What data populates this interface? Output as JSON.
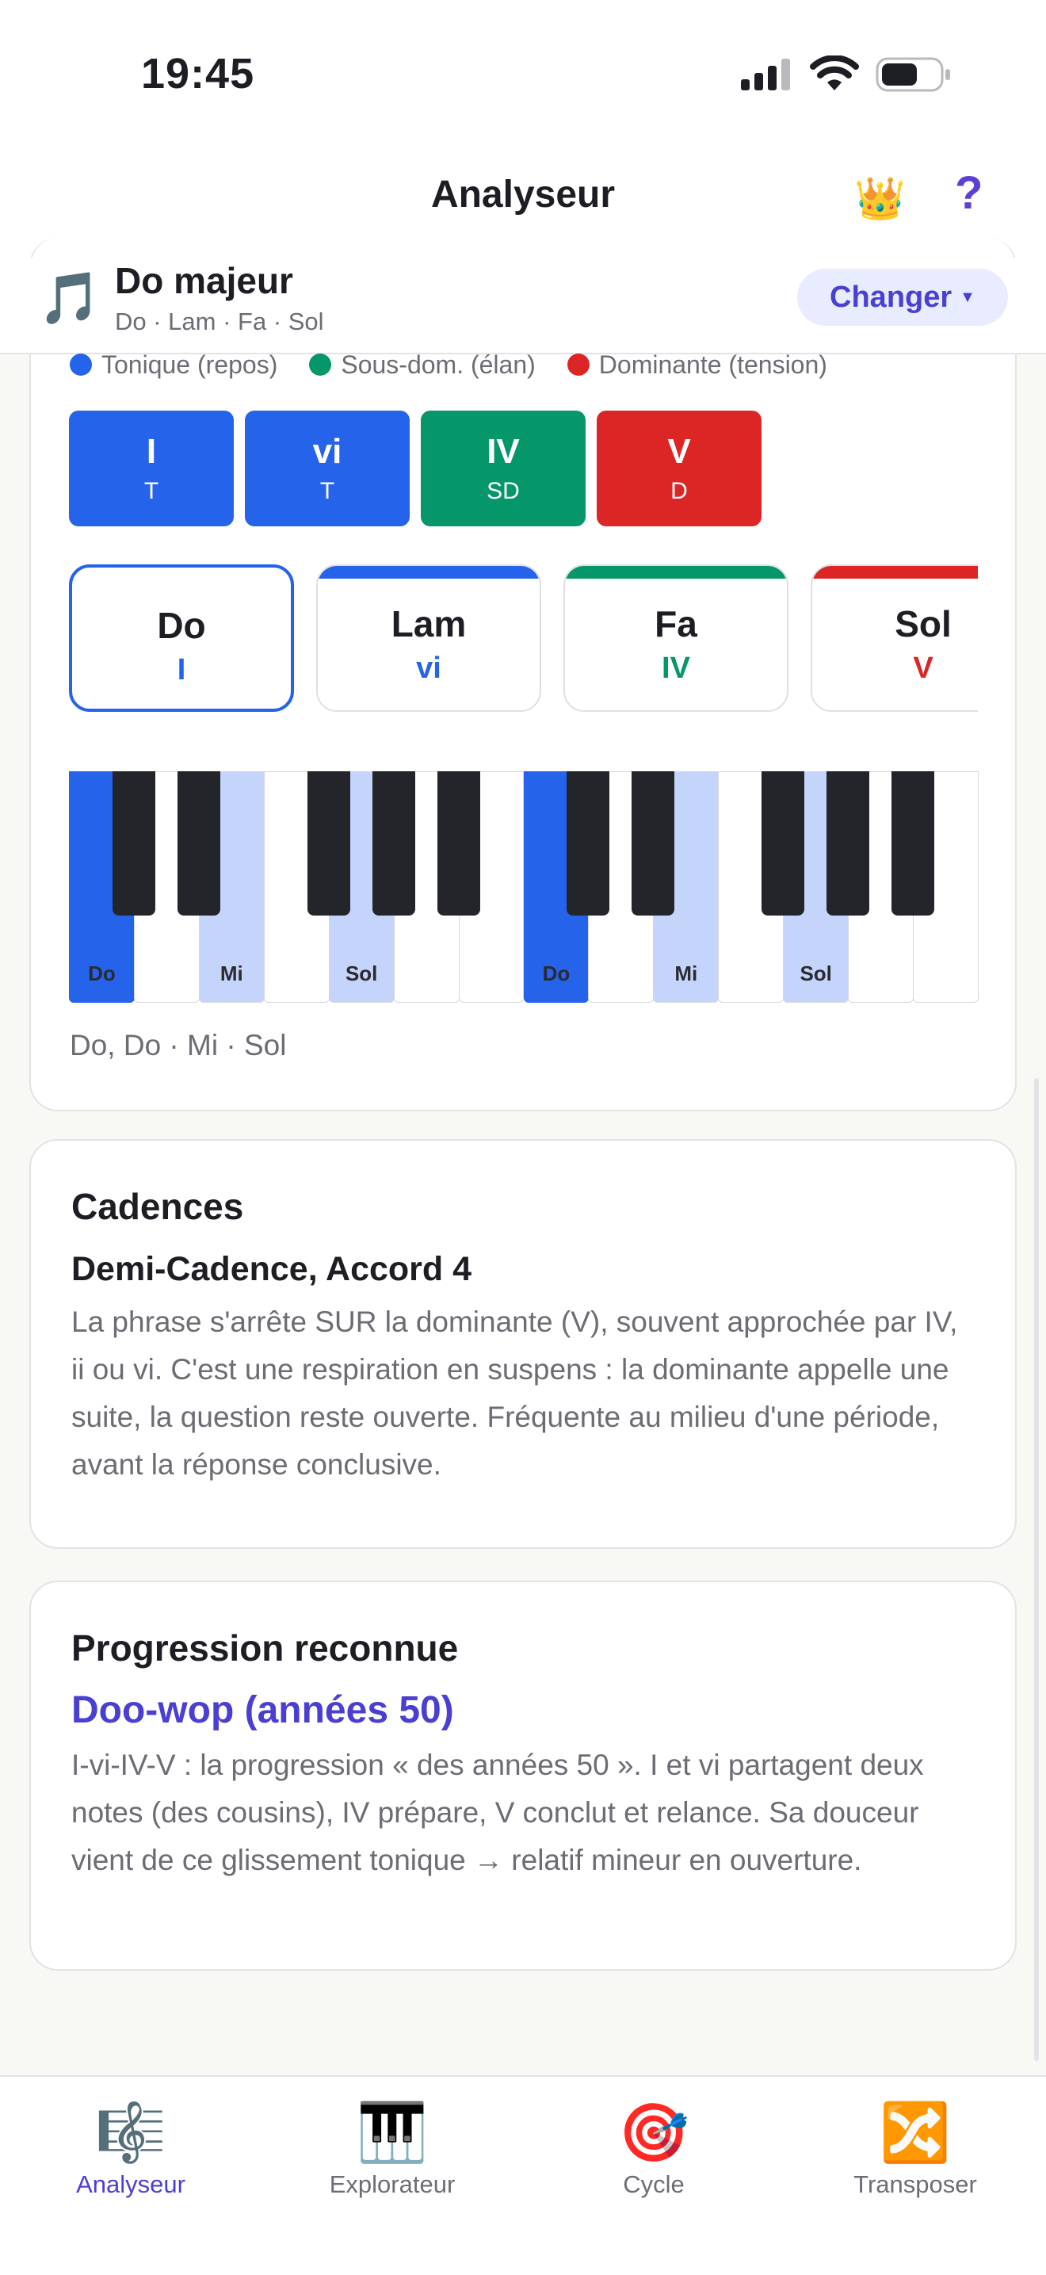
{
  "status_bar": {
    "time": "19:45"
  },
  "nav": {
    "title": "Analyseur",
    "help": "?"
  },
  "key": {
    "name": "Do majeur",
    "chords_summary": "Do · Lam · Fa · Sol",
    "change_label": "Changer",
    "change_caret": "▼"
  },
  "legend": [
    {
      "label": "Tonique (repos)",
      "color": "#2563EB"
    },
    {
      "label": "Sous-dom. (élan)",
      "color": "#059669"
    },
    {
      "label": "Dominante (tension)",
      "color": "#DC2626"
    }
  ],
  "functions": [
    {
      "roman": "I",
      "func": "T",
      "color": "#2563EB"
    },
    {
      "roman": "vi",
      "func": "T",
      "color": "#2563EB"
    },
    {
      "roman": "IV",
      "func": "SD",
      "color": "#059669"
    },
    {
      "roman": "V",
      "func": "D",
      "color": "#DC2626"
    }
  ],
  "chords": [
    {
      "name": "Do",
      "roman": "I",
      "color": "#2563EB",
      "selected": true
    },
    {
      "name": "Lam",
      "roman": "vi",
      "color": "#2563EB",
      "selected": false
    },
    {
      "name": "Fa",
      "roman": "IV",
      "color": "#059669",
      "selected": false
    },
    {
      "name": "Sol",
      "roman": "V",
      "color": "#DC2626",
      "selected": false
    }
  ],
  "piano": {
    "white_keys": [
      {
        "label": "Do",
        "state": "root"
      },
      {
        "label": "",
        "state": "off"
      },
      {
        "label": "Mi",
        "state": "on"
      },
      {
        "label": "",
        "state": "off"
      },
      {
        "label": "Sol",
        "state": "on"
      },
      {
        "label": "",
        "state": "off"
      },
      {
        "label": "",
        "state": "off"
      },
      {
        "label": "Do",
        "state": "root"
      },
      {
        "label": "",
        "state": "off"
      },
      {
        "label": "Mi",
        "state": "on"
      },
      {
        "label": "",
        "state": "off"
      },
      {
        "label": "Sol",
        "state": "on"
      },
      {
        "label": "",
        "state": "off"
      },
      {
        "label": "",
        "state": "off"
      }
    ],
    "colors": {
      "root": "#2563EB",
      "on": "#C5D4FB",
      "off": "#FFFFFF"
    }
  },
  "chord_notes": "Do, Do · Mi · Sol",
  "cadences": {
    "title": "Cadences",
    "subtitle": "Demi-Cadence, Accord 4",
    "body": "La phrase s'arrête SUR la dominante (V), souvent approchée par IV, ii ou vi. C'est une respiration en suspens : la dominante appelle une suite, la question reste ouverte. Fréquente au milieu d'une période, avant la réponse conclusive."
  },
  "progression": {
    "title": "Progression reconnue",
    "name": "Doo-wop (années 50)",
    "body": "I-vi-IV-V : la progression « des années 50 ». I et vi partagent deux notes (des cousins), IV prépare, V conclut et relance. Sa douceur vient de ce glissement tonique → relatif mineur en ouverture."
  },
  "tabs": [
    {
      "label": "Analyseur",
      "icon": "🎼",
      "active": true
    },
    {
      "label": "Explorateur",
      "icon": "🎹",
      "active": false
    },
    {
      "label": "Cycle",
      "icon": "🎯",
      "active": false
    },
    {
      "label": "Transposer",
      "icon": "🔀",
      "active": false
    }
  ],
  "accent_color": "#4A3FD3"
}
